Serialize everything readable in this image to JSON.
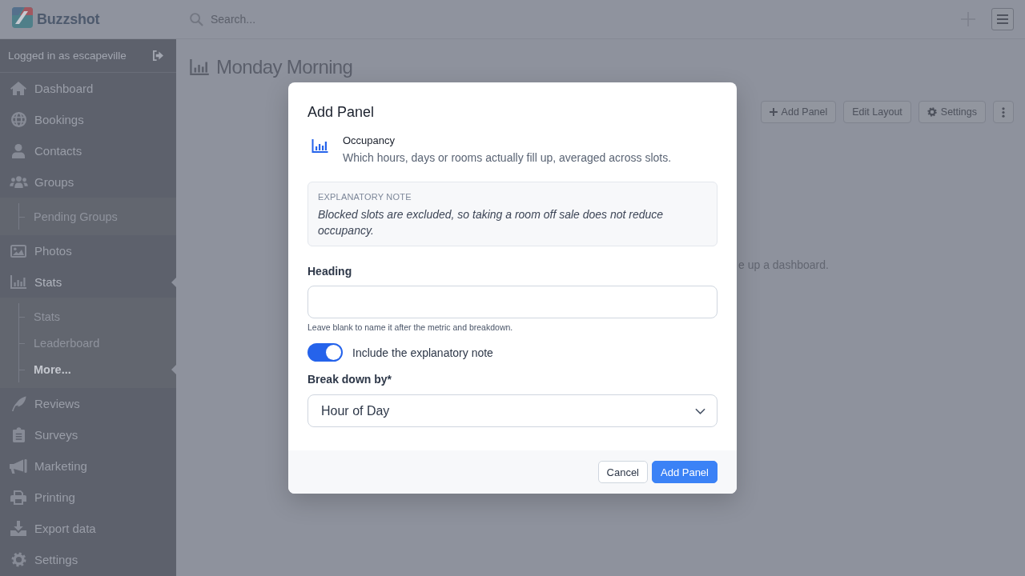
{
  "topbar": {
    "brand": "Buzzshot",
    "search": {
      "placeholder": "Search..."
    }
  },
  "sidebar": {
    "user_label": "Logged in as escapeville",
    "items": [
      {
        "label": "Dashboard",
        "selected": false
      },
      {
        "label": "Bookings",
        "selected": false
      },
      {
        "label": "Contacts",
        "selected": false
      },
      {
        "label": "Groups",
        "selected": false,
        "children": [
          {
            "label": "Pending Groups",
            "selected": false
          }
        ]
      },
      {
        "label": "Photos",
        "selected": false
      },
      {
        "label": "Stats",
        "selected": true,
        "children": [
          {
            "label": "Stats",
            "selected": false
          },
          {
            "label": "Leaderboard",
            "selected": false
          },
          {
            "label": "More...",
            "selected": true
          }
        ]
      },
      {
        "label": "Reviews",
        "selected": false
      },
      {
        "label": "Surveys",
        "selected": false
      },
      {
        "label": "Marketing",
        "selected": false
      },
      {
        "label": "Printing",
        "selected": false
      },
      {
        "label": "Export data",
        "selected": false
      },
      {
        "label": "Settings",
        "selected": false
      }
    ]
  },
  "dashboard": {
    "title": "Monday Morning",
    "toolbar": [
      "Add Panel",
      "Edit Layout",
      "Settings"
    ],
    "message": "e up a dashboard."
  },
  "modal": {
    "title": "Add Panel",
    "metric": {
      "name": "Occupancy",
      "description": "Which hours, days or rooms actually fill up, averaged across slots."
    },
    "note": {
      "label": "EXPLANATORY NOTE",
      "text": "Blocked slots are excluded, so taking a room off sale does not reduce occupancy."
    },
    "heading_field": {
      "label": "Heading",
      "hint": "Leave blank to name it after the metric and breakdown."
    },
    "include_note": {
      "label": "Include the explanatory note",
      "on": true
    },
    "breakdown": {
      "label": "Break down by*",
      "value": "Hour of Day"
    },
    "buttons": [
      {
        "label": "Cancel",
        "kind": "secondary"
      },
      {
        "label": "Add Panel",
        "kind": "primary"
      }
    ]
  }
}
